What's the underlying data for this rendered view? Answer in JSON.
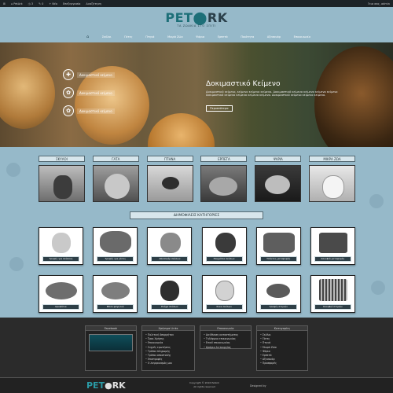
{
  "admin_bar": {
    "items": [
      "⊞",
      "⌂ PetArk",
      "◷ 3",
      "✎ 0",
      "+ Νέο",
      "Επεξεργασία",
      "Αναζήτηση"
    ],
    "right": "Γεια σας, admin"
  },
  "logo": {
    "part1": "PET",
    "part2": "RK",
    "tagline": "ΤΑ ΖΩΑΚΙΑ ΣΤΟ ΣΠΙΤΙ"
  },
  "nav": {
    "home_icon": "home-icon",
    "items": [
      "Σκύλοι",
      "Γάτες",
      "Πτηνά",
      "Μικρά Ζώα",
      "Ψάρια",
      "Ερπετά",
      "Ποιότητα",
      "Αξεσουάρ",
      "Επικοινωνία"
    ]
  },
  "hero": {
    "features": [
      {
        "icon": "bone-icon",
        "label": "Δοκιμαστικό κείμενο"
      },
      {
        "icon": "paw-icon",
        "label": "Δοκιμαστικό κείμενο"
      },
      {
        "icon": "paw-icon",
        "label": "Δοκιμαστικό κείμενο"
      }
    ],
    "title": "Δοκιμαστικό Κείμενο",
    "body": "Δοκιμαστικό κείμενο, κείμενο κείμενο κείμενο. Δοκιμαστικό κείμενο κείμενο κείμενο κείμενο δοκιμαστικό κείμενο κείμενο κείμενο κείμενο. Δοκιμαστικό κείμενο κείμενο κείμενο.",
    "button": "Περισσότερα"
  },
  "pets": [
    "ΣΚΥΛΟΙ",
    "ΓΑΤΑ",
    "ΠΤΗΝΑ",
    "ΕΡΠΕΤΑ",
    "ΨΑΡΙΑ",
    "ΜΙΚΡΑ ΖΩΑ"
  ],
  "popular_title": "ΔΗΜΟΦΙΛΕΙΣ ΚΑΤΗΓΟΡΙΕΣ",
  "categories": [
    "Τροφές για σκύλους",
    "Τροφές για γάτες",
    "Αξεσουάρ σκύλων",
    "Παιχνίδια σκύλων",
    "Τσάντες μεταφοράς",
    "Κλουβιά μεταφοράς",
    "Κρεβάτια",
    "Μπολ φαγητού",
    "Ρούχα σκύλων",
    "Σνακ σκύλων",
    "Τροφές πτηνών",
    "Κλουβιά πτηνών"
  ],
  "footer": {
    "box1": {
      "title": "Facebook"
    },
    "box2": {
      "title": "Χρήσιμα Links",
      "items": [
        "Πολιτική Απορρήτου",
        "Όροι Χρήσης",
        "Επικοινωνία",
        "Συχνές ερωτήσεις",
        "Τρόποι πληρωμής",
        "Τρόποι αποστολής",
        "Επιστροφές",
        "Ο λογαριασμός μου"
      ]
    },
    "box3": {
      "title": "Επικοινωνία",
      "items": [
        "Διεύθυνση καταστήματος",
        "Τηλέφωνο επικοινωνίας",
        "Email επικοινωνίας",
        "Ωράριο λειτουργίας"
      ]
    },
    "box4": {
      "title": "Κατηγορίες",
      "items": [
        "Σκύλοι",
        "Γάτες",
        "Πτηνά",
        "Μικρά Ζώα",
        "Ψάρια",
        "Ερπετά",
        "Αξεσουάρ",
        "Προσφορές"
      ]
    }
  },
  "bottom": {
    "logo1": "PET",
    "logo2": "RK",
    "copyright": "Copyright © 2016 PetArk",
    "rights": "All rights reserved",
    "credit": "Designed by"
  },
  "colors": {
    "header_bg": "#96b9c9",
    "accent": "#1d6f78",
    "footer_bg": "#2b2b2b"
  }
}
